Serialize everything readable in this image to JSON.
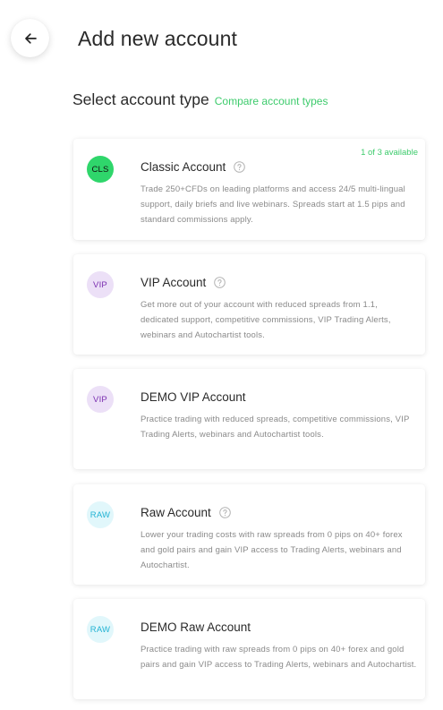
{
  "header": {
    "back_icon": "arrow-left-icon",
    "title": "Add new account"
  },
  "section": {
    "title": "Select account type",
    "compare_link": "Compare account types"
  },
  "colors": {
    "accent_green": "#3dcb6c",
    "cls_badge_bg": "#2fd66b",
    "vip_badge_bg": "#ece0f7",
    "vip_badge_fg": "#7a2fb0",
    "raw_badge_bg": "#e1f7fb",
    "raw_badge_fg": "#23b3d3"
  },
  "accounts": [
    {
      "badge": "CLS",
      "title": "Classic Account",
      "has_help": true,
      "availability": "1 of 3 available",
      "description": "Trade 250+CFDs on leading platforms and access 24/5 multi-lingual support, daily briefs and live webinars. Spreads start at 1.5 pips and standard commissions apply."
    },
    {
      "badge": "VIP",
      "title": "VIP Account",
      "has_help": true,
      "description": "Get more out of your account with reduced spreads from 1.1, dedicated support, competitive commissions, VIP Trading Alerts, webinars and Autochartist tools."
    },
    {
      "badge": "VIP",
      "title": "DEMO VIP Account",
      "has_help": false,
      "description": "Practice trading with reduced spreads, competitive commissions, VIP Trading Alerts, webinars and Autochartist tools."
    },
    {
      "badge": "RAW",
      "title": "Raw Account",
      "has_help": true,
      "description": "Lower your trading costs with raw spreads from 0 pips on 40+ forex and gold pairs and gain VIP access to Trading Alerts, webinars and Autochartist."
    },
    {
      "badge": "RAW",
      "title": "DEMO Raw Account",
      "has_help": false,
      "description": "Practice trading with raw spreads from 0 pips on 40+ forex and gold pairs and gain VIP access to Trading Alerts, webinars and Autochartist."
    }
  ]
}
